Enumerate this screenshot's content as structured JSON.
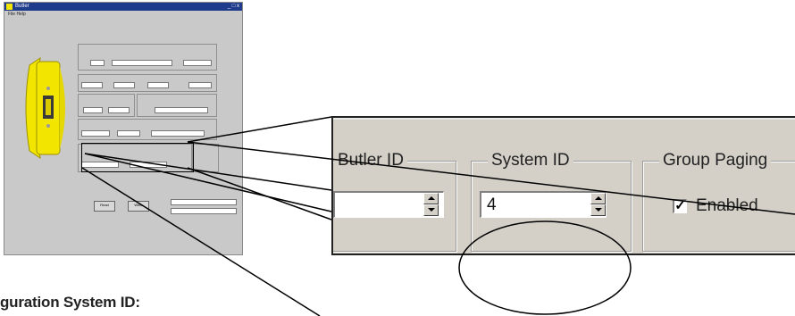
{
  "thumbnail": {
    "title": "Butler",
    "menu": "File Help",
    "window_controls": "_ □ x",
    "buttons": [
      "Read",
      "Write"
    ]
  },
  "zoom": {
    "butler_id": {
      "label": "Butler ID",
      "value": ""
    },
    "system_id": {
      "label": "System ID",
      "value": "4"
    },
    "group_paging": {
      "label": "Group Paging",
      "checkbox_label": "Enabled",
      "checked": true
    }
  },
  "caption": "guration System ID:",
  "colors": {
    "device_yellow": "#f2e600",
    "dialog_gray": "#d4d0c8"
  }
}
